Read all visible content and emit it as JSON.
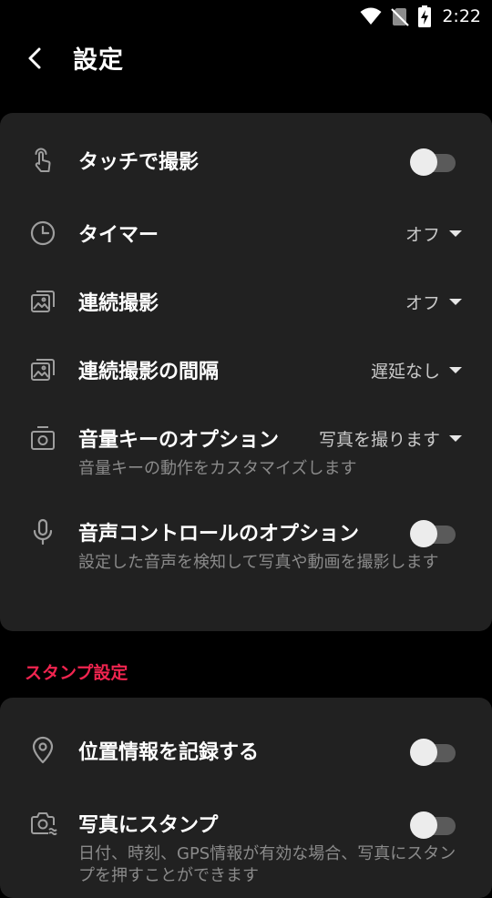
{
  "status": {
    "time": "2:22"
  },
  "header": {
    "title": "設定"
  },
  "settings": {
    "touch_capture": {
      "label": "タッチで撮影",
      "enabled": false
    },
    "timer": {
      "label": "タイマー",
      "value": "オフ"
    },
    "burst": {
      "label": "連続撮影",
      "value": "オフ"
    },
    "burst_interval": {
      "label": "連続撮影の間隔",
      "value": "遅延なし"
    },
    "volume_key": {
      "label": "音量キーのオプション",
      "value": "写真を撮ります",
      "description": "音量キーの動作をカスタマイズします"
    },
    "voice_control": {
      "label": "音声コントロールのオプション",
      "enabled": false,
      "description": "設定した音声を検知して写真や動画を撮影します"
    }
  },
  "stamp_section": {
    "header": "スタンプ設定",
    "location": {
      "label": "位置情報を記録する",
      "enabled": false
    },
    "photo_stamp": {
      "label": "写真にスタンプ",
      "enabled": false,
      "description": "日付、時刻、GPS情報が有効な場合、写真にスタンプを押すことができます"
    }
  },
  "colors": {
    "background": "#000000",
    "card": "#212121",
    "accent": "#f0244f",
    "secondary_text": "#8a8a8a"
  }
}
